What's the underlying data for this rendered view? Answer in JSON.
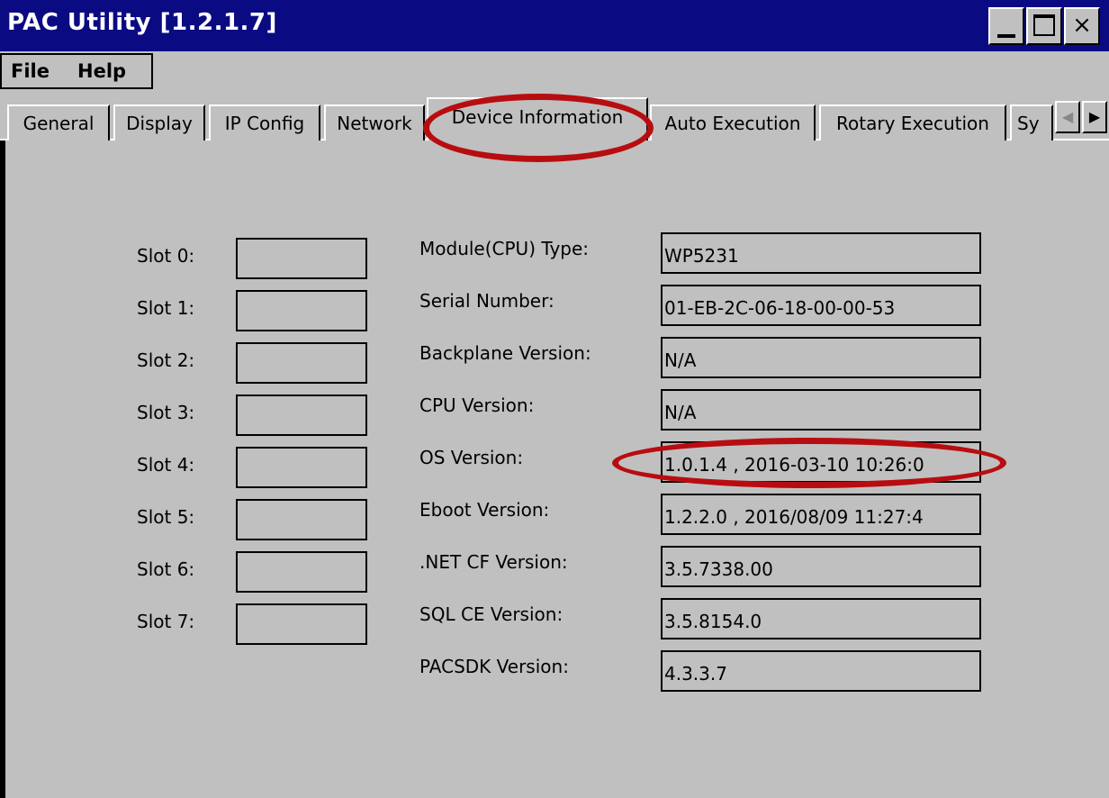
{
  "window": {
    "title": "PAC Utility  [1.2.1.7]",
    "close_glyph": "×"
  },
  "menu": {
    "items": [
      "File",
      "Help"
    ]
  },
  "tabs": [
    {
      "label": "General"
    },
    {
      "label": "Display"
    },
    {
      "label": "IP Config"
    },
    {
      "label": "Network"
    },
    {
      "label": "Device Information",
      "selected": true
    },
    {
      "label": "Auto Execution"
    },
    {
      "label": "Rotary Execution"
    },
    {
      "label": "Sy"
    }
  ],
  "tab_scroll": {
    "left_glyph": "◀",
    "right_glyph": "▶"
  },
  "slots": [
    {
      "label": "Slot 0:",
      "value": ""
    },
    {
      "label": "Slot 1:",
      "value": ""
    },
    {
      "label": "Slot 2:",
      "value": ""
    },
    {
      "label": "Slot 3:",
      "value": ""
    },
    {
      "label": "Slot 4:",
      "value": ""
    },
    {
      "label": "Slot 5:",
      "value": ""
    },
    {
      "label": "Slot 6:",
      "value": ""
    },
    {
      "label": "Slot 7:",
      "value": ""
    }
  ],
  "device_info": [
    {
      "label": "Module(CPU) Type:",
      "value": "WP5231"
    },
    {
      "label": "Serial Number:",
      "value": "01-EB-2C-06-18-00-00-53"
    },
    {
      "label": "Backplane Version:",
      "value": "N/A"
    },
    {
      "label": "CPU Version:",
      "value": "N/A"
    },
    {
      "label": "OS Version:",
      "value": "1.0.1.4 , 2016-03-10 10:26:0"
    },
    {
      "label": "Eboot Version:",
      "value": "1.2.2.0 , 2016/08/09 11:27:4"
    },
    {
      "label": ".NET CF Version:",
      "value": "3.5.7338.00"
    },
    {
      "label": "SQL CE Version:",
      "value": "3.5.8154.0"
    },
    {
      "label": "PACSDK Version:",
      "value": "4.3.3.7"
    }
  ],
  "colors": {
    "title_bar": "#0a0a82",
    "face": "#c0c0c0",
    "highlight_annotation": "#b80d10"
  }
}
